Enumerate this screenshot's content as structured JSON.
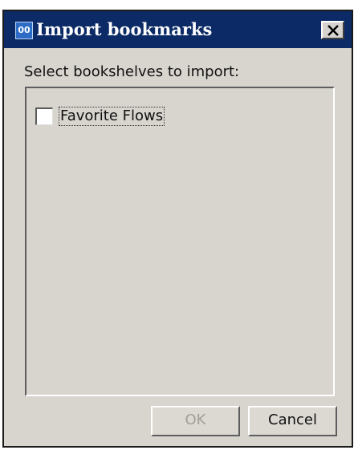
{
  "window": {
    "title": "Import bookmarks",
    "app_icon_text": "00",
    "close_icon": "close-icon"
  },
  "dialog": {
    "prompt": "Select bookshelves to import:",
    "bookshelves": [
      {
        "label": "Favorite Flows",
        "checked": false
      }
    ]
  },
  "buttons": {
    "ok_label": "OK",
    "ok_enabled": false,
    "cancel_label": "Cancel"
  },
  "colors": {
    "titlebar": "#0b2a66",
    "dialog_background": "#d8d5cf",
    "disabled_text": "#a29f99"
  }
}
